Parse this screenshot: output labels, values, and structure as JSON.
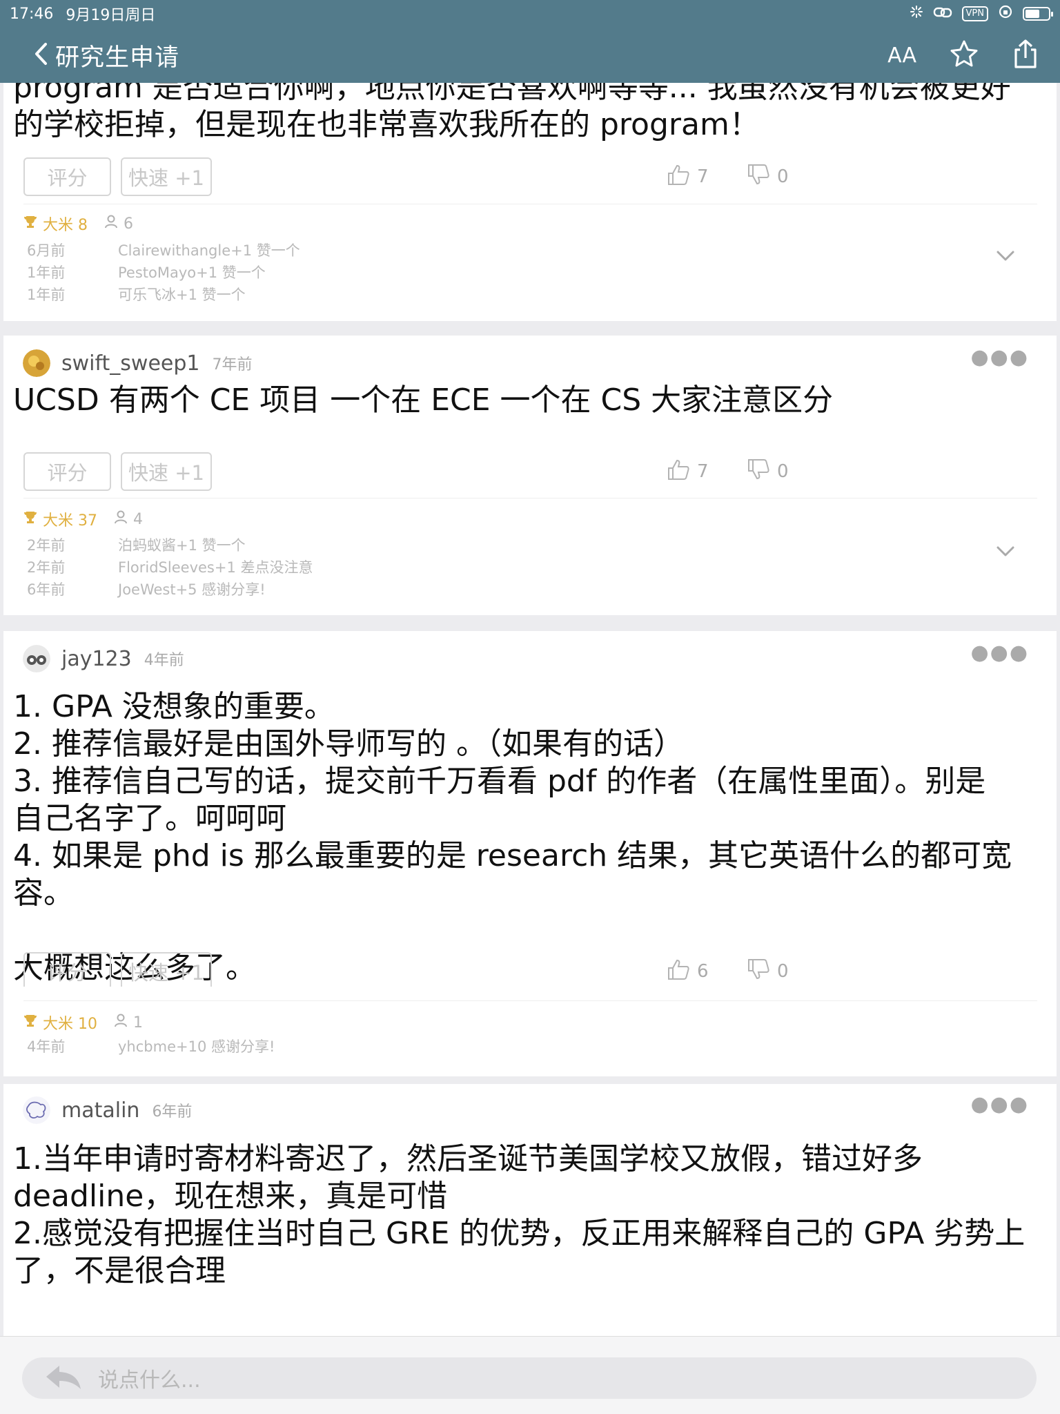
{
  "status": {
    "time": "17:46",
    "date": "9月19日周日",
    "vpn": "VPN"
  },
  "nav": {
    "title": "研究生申请",
    "font_button": "AA"
  },
  "posts": [
    {
      "text": "program 是否适合你啊，地点你是否喜欢啊等等... 我虽然没有机会被更好\n的学校拒掉，但是现在也非常喜欢我所在的 program！",
      "rate": "评分",
      "quick": "快速 +1",
      "likes": "7",
      "dislikes": "0",
      "rice": "大米 8",
      "people": "6",
      "log": [
        {
          "when": "6月前",
          "what": "Clairewithangle+1 赞一个"
        },
        {
          "when": "1年前",
          "what": "PestoMayo+1 赞一个"
        },
        {
          "when": "1年前",
          "what": "可乐飞冰+1 赞一个"
        }
      ]
    },
    {
      "user": "swift_sweep1",
      "time": "7年前",
      "text": "UCSD 有两个 CE 项目 一个在 ECE 一个在 CS 大家注意区分",
      "rate": "评分",
      "quick": "快速 +1",
      "likes": "7",
      "dislikes": "0",
      "rice": "大米 37",
      "people": "4",
      "log": [
        {
          "when": "2年前",
          "what": "泊蚂蚁酱+1 赞一个"
        },
        {
          "when": "2年前",
          "what": "FloridSleeves+1 差点没注意"
        },
        {
          "when": "6年前",
          "what": "JoeWest+5 感谢分享!"
        }
      ]
    },
    {
      "user": "jay123",
      "time": "4年前",
      "text": "1. GPA 没想象的重要。\n2. 推荐信最好是由国外导师写的 。（如果有的话）\n3. 推荐信自己写的话，提交前千万看看 pdf 的作者（在属性里面）。别是\n自己名字了。呵呵呵\n4. 如果是 phd is 那么最重要的是 research 结果，其它英语什么的都可宽\n容。\n\n大概想这么多了。",
      "rate": "评分",
      "quick": "快速 +1",
      "likes": "6",
      "dislikes": "0",
      "rice": "大米 10",
      "people": "1",
      "log": [
        {
          "when": "4年前",
          "what": "yhcbme+10 感谢分享!"
        }
      ]
    },
    {
      "user": "matalin",
      "time": "6年前",
      "text": "1.当年申请时寄材料寄迟了，然后圣诞节美国学校又放假，错过好多\ndeadline，现在想来，真是可惜\n2.感觉没有把握住当时自己 GRE 的优势，反正用来解释自己的 GPA 劣势上\n了，不是很合理"
    }
  ],
  "composer": {
    "placeholder": "说点什么..."
  },
  "colors": {
    "navbar": "#537b8b",
    "trophy": "#e0b040",
    "muted": "#aaaaaa"
  }
}
